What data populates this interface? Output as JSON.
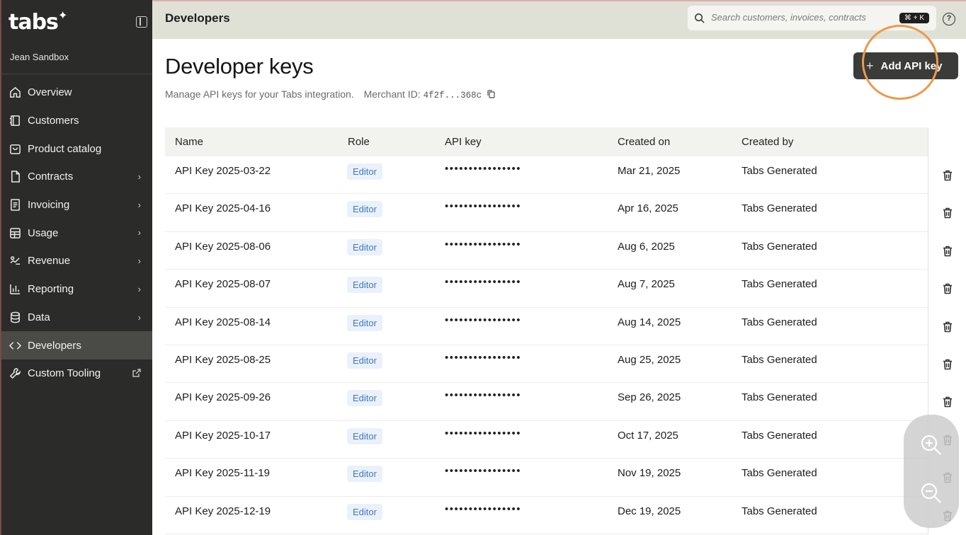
{
  "sidebar": {
    "logo": "tabs",
    "workspace": "Jean Sandbox",
    "items": [
      {
        "label": "Overview",
        "icon": "home-icon",
        "chevron": false
      },
      {
        "label": "Customers",
        "icon": "customers-icon",
        "chevron": false
      },
      {
        "label": "Product catalog",
        "icon": "bag-icon",
        "chevron": false
      },
      {
        "label": "Contracts",
        "icon": "file-icon",
        "chevron": true
      },
      {
        "label": "Invoicing",
        "icon": "invoice-icon",
        "chevron": true
      },
      {
        "label": "Usage",
        "icon": "table-icon",
        "chevron": true
      },
      {
        "label": "Revenue",
        "icon": "revenue-icon",
        "chevron": true
      },
      {
        "label": "Reporting",
        "icon": "chart-icon",
        "chevron": true
      },
      {
        "label": "Data",
        "icon": "database-icon",
        "chevron": true
      },
      {
        "label": "Developers",
        "icon": "code-icon",
        "chevron": false,
        "active": true
      },
      {
        "label": "Custom Tooling",
        "icon": "wrench-icon",
        "chevron": false,
        "external": true
      }
    ]
  },
  "header": {
    "title": "Developers",
    "search_placeholder": "Search customers, invoices, contracts",
    "shortcut": "⌘ + K",
    "help": "?"
  },
  "main": {
    "title": "Developer keys",
    "subtitle": "Manage API keys for your Tabs integration.",
    "merchant_label": "Merchant ID:",
    "merchant_id": "4f2f...368c",
    "add_button": "Add API key",
    "columns": [
      "Name",
      "Role",
      "API key",
      "Created on",
      "Created by"
    ],
    "rows": [
      {
        "name": "API Key 2025-03-22",
        "role": "Editor",
        "key": "••••••••••••••••",
        "created_on": "Mar 21, 2025",
        "created_by": "Tabs Generated"
      },
      {
        "name": "API Key 2025-04-16",
        "role": "Editor",
        "key": "••••••••••••••••",
        "created_on": "Apr 16, 2025",
        "created_by": "Tabs Generated"
      },
      {
        "name": "API Key 2025-08-06",
        "role": "Editor",
        "key": "••••••••••••••••",
        "created_on": "Aug 6, 2025",
        "created_by": "Tabs Generated"
      },
      {
        "name": "API Key 2025-08-07",
        "role": "Editor",
        "key": "••••••••••••••••",
        "created_on": "Aug 7, 2025",
        "created_by": "Tabs Generated"
      },
      {
        "name": "API Key 2025-08-14",
        "role": "Editor",
        "key": "••••••••••••••••",
        "created_on": "Aug 14, 2025",
        "created_by": "Tabs Generated"
      },
      {
        "name": "API Key 2025-08-25",
        "role": "Editor",
        "key": "••••••••••••••••",
        "created_on": "Aug 25, 2025",
        "created_by": "Tabs Generated"
      },
      {
        "name": "API Key 2025-09-26",
        "role": "Editor",
        "key": "••••••••••••••••",
        "created_on": "Sep 26, 2025",
        "created_by": "Tabs Generated"
      },
      {
        "name": "API Key 2025-10-17",
        "role": "Editor",
        "key": "••••••••••••••••",
        "created_on": "Oct 17, 2025",
        "created_by": "Tabs Generated"
      },
      {
        "name": "API Key 2025-11-19",
        "role": "Editor",
        "key": "••••••••••••••••",
        "created_on": "Nov 19, 2025",
        "created_by": "Tabs Generated"
      },
      {
        "name": "API Key 2025-12-19",
        "role": "Editor",
        "key": "••••••••••••••••",
        "created_on": "Dec 19, 2025",
        "created_by": "Tabs Generated"
      }
    ]
  },
  "colors": {
    "sidebar_bg": "#2b2b29",
    "topbar_bg": "#dfe1d6",
    "button_bg": "#3b3b3a",
    "highlight": "#ec9a4a",
    "badge_bg": "#eaf1fa",
    "badge_text": "#3f78c0"
  }
}
